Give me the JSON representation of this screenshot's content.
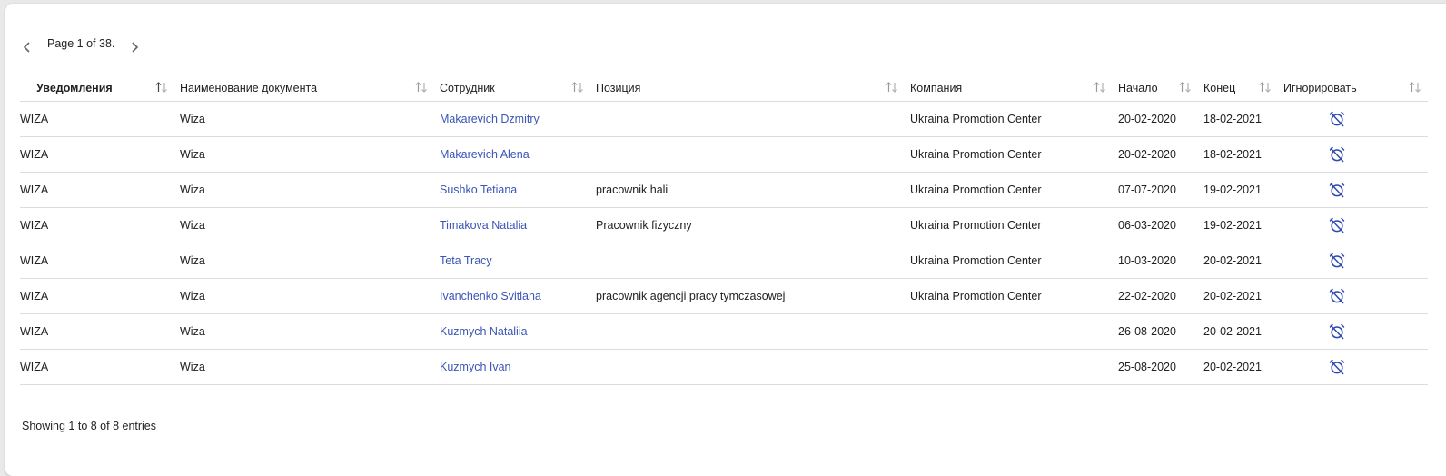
{
  "pager": {
    "text": "Page 1 of 38."
  },
  "table": {
    "headers": [
      "Уведомления",
      "Наименование документа",
      "Сотрудник",
      "Позиция",
      "Компания",
      "Начало",
      "Конец",
      "Игнорировать"
    ],
    "rows": [
      {
        "notification": "WIZA",
        "document": "Wiza",
        "employee": "Makarevich Dzmitry",
        "position": "",
        "company": "Ukraina Promotion Center",
        "start": "20-02-2020",
        "end": "18-02-2021"
      },
      {
        "notification": "WIZA",
        "document": "Wiza",
        "employee": "Makarevich Alena",
        "position": "",
        "company": "Ukraina Promotion Center",
        "start": "20-02-2020",
        "end": "18-02-2021"
      },
      {
        "notification": "WIZA",
        "document": "Wiza",
        "employee": "Sushko Tetiana",
        "position": "pracownik hali",
        "company": "Ukraina Promotion Center",
        "start": "07-07-2020",
        "end": "19-02-2021"
      },
      {
        "notification": "WIZA",
        "document": "Wiza",
        "employee": "Timakova Natalia",
        "position": "Pracownik fizyczny",
        "company": "Ukraina Promotion Center",
        "start": "06-03-2020",
        "end": "19-02-2021"
      },
      {
        "notification": "WIZA",
        "document": "Wiza",
        "employee": "Teta Tracy",
        "position": "",
        "company": "Ukraina Promotion Center",
        "start": "10-03-2020",
        "end": "20-02-2021"
      },
      {
        "notification": "WIZA",
        "document": "Wiza",
        "employee": "Ivanchenko Svitlana",
        "position": "pracownik agencji pracy tymczasowej",
        "company": "Ukraina Promotion Center",
        "start": "22-02-2020",
        "end": "20-02-2021"
      },
      {
        "notification": "WIZA",
        "document": "Wiza",
        "employee": "Kuzmych Nataliia",
        "position": "",
        "company": "",
        "start": "26-08-2020",
        "end": "20-02-2021"
      },
      {
        "notification": "WIZA",
        "document": "Wiza",
        "employee": "Kuzmych Ivan",
        "position": "",
        "company": "",
        "start": "25-08-2020",
        "end": "20-02-2021"
      }
    ]
  },
  "footer": {
    "text": "Showing 1 to 8 of 8 entries"
  },
  "icons": {
    "prev": "chevron-left-icon",
    "next": "chevron-right-icon",
    "sort": "sort-arrows-icon",
    "ignore": "alarm-off-icon"
  },
  "colors": {
    "link": "#3a55b6",
    "icon": "#2f4bb0"
  }
}
